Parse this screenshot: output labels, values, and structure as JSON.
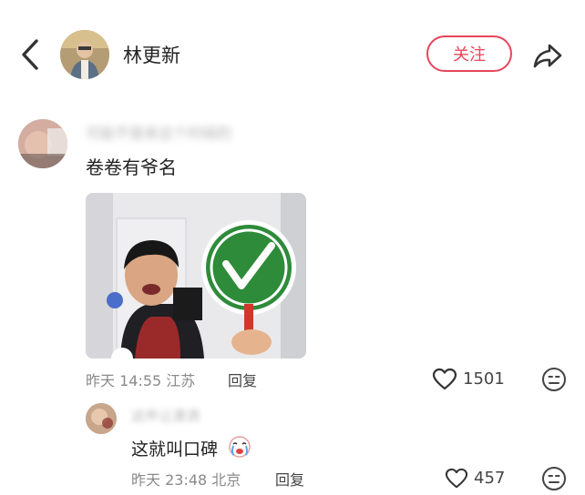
{
  "header": {
    "title": "林更新",
    "follow_label": "关注"
  },
  "comment": {
    "username": "可能不是来这个时候的",
    "text": "卷卷有爷名",
    "time": "昨天 14:55",
    "location": "江苏",
    "meta": "昨天 14:55 江苏",
    "reply_label": "回复",
    "likes": "1501"
  },
  "reply": {
    "username": "这件让潇洒",
    "text": "这就叫口碑",
    "meta": "昨天 23:48 北京",
    "reply_label": "回复",
    "likes": "457"
  },
  "colors": {
    "accent": "#e8455a",
    "meta_text": "#8a8a8a",
    "check_sign": "#2e8b3a"
  },
  "icons": [
    "back-icon",
    "share-icon",
    "heart-icon",
    "emoji-icon",
    "crying-emoji-icon"
  ]
}
